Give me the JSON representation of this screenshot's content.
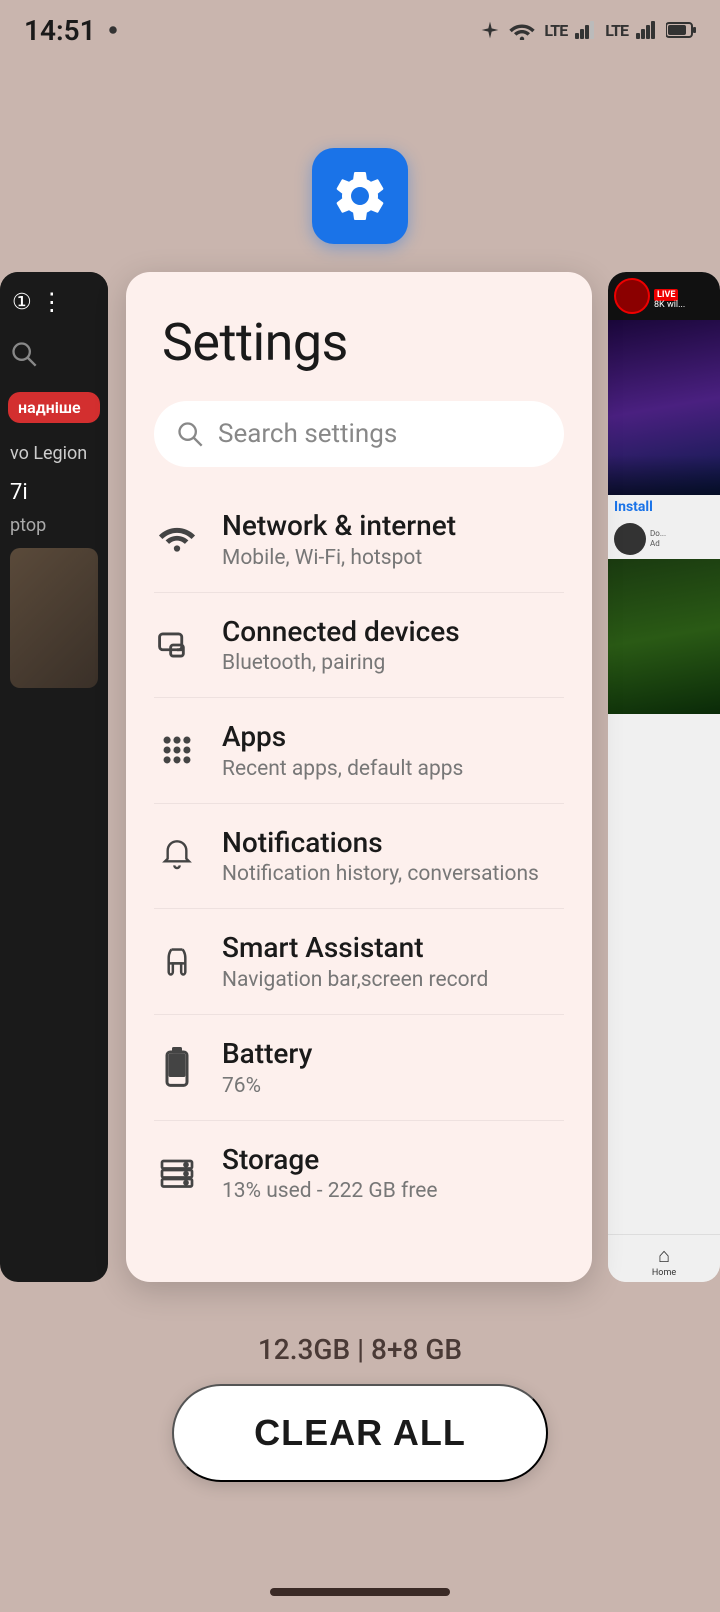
{
  "status_bar": {
    "time": "14:51",
    "icons": [
      "sim-dot",
      "wifi",
      "lte",
      "signal1",
      "lte2",
      "signal2",
      "battery"
    ]
  },
  "app_icon": {
    "label": "Settings gear icon"
  },
  "settings": {
    "title": "Settings",
    "search_placeholder": "Search settings",
    "items": [
      {
        "id": "network",
        "title": "Network & internet",
        "subtitle": "Mobile, Wi-Fi, hotspot",
        "icon": "wifi"
      },
      {
        "id": "connected-devices",
        "title": "Connected devices",
        "subtitle": "Bluetooth, pairing",
        "icon": "devices"
      },
      {
        "id": "apps",
        "title": "Apps",
        "subtitle": "Recent apps, default apps",
        "icon": "apps"
      },
      {
        "id": "notifications",
        "title": "Notifications",
        "subtitle": "Notification history, conversations",
        "icon": "bell"
      },
      {
        "id": "smart-assistant",
        "title": "Smart Assistant",
        "subtitle": "Navigation bar,screen record",
        "icon": "hand"
      },
      {
        "id": "battery",
        "title": "Battery",
        "subtitle": "76%",
        "icon": "battery"
      },
      {
        "id": "storage",
        "title": "Storage",
        "subtitle": "13% used - 222 GB free",
        "icon": "storage"
      }
    ]
  },
  "bottom": {
    "memory_info": "12.3GB | 8+8 GB",
    "clear_all_label": "CLEAR ALL"
  },
  "left_card": {
    "num": "①",
    "search_label": "search",
    "red_btn": "надніше",
    "legion_text": "vo Legion",
    "model_main": "7i",
    "model_sub": "ptop"
  },
  "right_card": {
    "live_label": "LIVE",
    "channel_name": "8K wil...",
    "install_label": "Install",
    "ad_label": "Ad",
    "home_label": "Home"
  }
}
